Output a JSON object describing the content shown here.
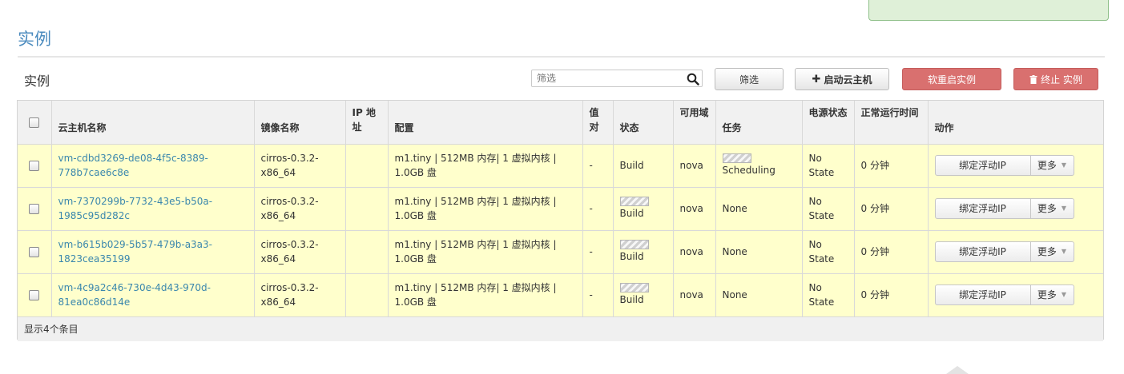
{
  "page": {
    "title": "实例",
    "section_title": "实例"
  },
  "toolbar": {
    "search_placeholder": "筛选",
    "filter_label": "筛选",
    "launch_label": "启动云主机",
    "soft_reboot_label": "软重启实例",
    "terminate_label": "终止 实例"
  },
  "table": {
    "headers": {
      "name": "云主机名称",
      "image": "镜像名称",
      "ip": "IP 地址",
      "config": "配置",
      "keypair": "值对",
      "status": "状态",
      "az": "可用域",
      "task": "任务",
      "power": "电源状态",
      "uptime": "正常运行时间",
      "actions": "动作"
    },
    "rows": [
      {
        "name": "vm-cdbd3269-de08-4f5c-8389-778b7cae6c8e",
        "image": "cirros-0.3.2-x86_64",
        "ip": "",
        "config": "m1.tiny | 512MB 内存| 1 虚拟内核 | 1.0GB 盘",
        "keypair": "-",
        "status": "Build",
        "az": "nova",
        "task": "Scheduling",
        "power": "No State",
        "uptime": "0 分钟",
        "action_label": "绑定浮动IP",
        "more_label": "更多"
      },
      {
        "name": "vm-7370299b-7732-43e5-b50a-1985c95d282c",
        "image": "cirros-0.3.2-x86_64",
        "ip": "",
        "config": "m1.tiny | 512MB 内存| 1 虚拟内核 | 1.0GB 盘",
        "keypair": "-",
        "status": "Build",
        "az": "nova",
        "task": "None",
        "power": "No State",
        "uptime": "0 分钟",
        "action_label": "绑定浮动IP",
        "more_label": "更多"
      },
      {
        "name": "vm-b615b029-5b57-479b-a3a3-1823cea35199",
        "image": "cirros-0.3.2-x86_64",
        "ip": "",
        "config": "m1.tiny | 512MB 内存| 1 虚拟内核 | 1.0GB 盘",
        "keypair": "-",
        "status": "Build",
        "az": "nova",
        "task": "None",
        "power": "No State",
        "uptime": "0 分钟",
        "action_label": "绑定浮动IP",
        "more_label": "更多"
      },
      {
        "name": "vm-4c9a2c46-730e-4d43-970d-81ea0c86d14e",
        "image": "cirros-0.3.2-x86_64",
        "ip": "",
        "config": "m1.tiny | 512MB 内存| 1 虚拟内核 | 1.0GB 盘",
        "keypair": "-",
        "status": "Build",
        "az": "nova",
        "task": "None",
        "power": "No State",
        "uptime": "0 分钟",
        "action_label": "绑定浮动IP",
        "more_label": "更多"
      }
    ],
    "footer": "显示4个条目"
  },
  "colors": {
    "accent": "#4b8bbe",
    "row_highlight": "#ffffcc",
    "danger": "#d9706f",
    "alert_success": "#dff0d8"
  },
  "icons": {
    "search": "search-icon",
    "plus": "plus-icon",
    "trash": "trash-icon",
    "caret": "caret-down-icon",
    "progress": "progress-bar-icon"
  }
}
